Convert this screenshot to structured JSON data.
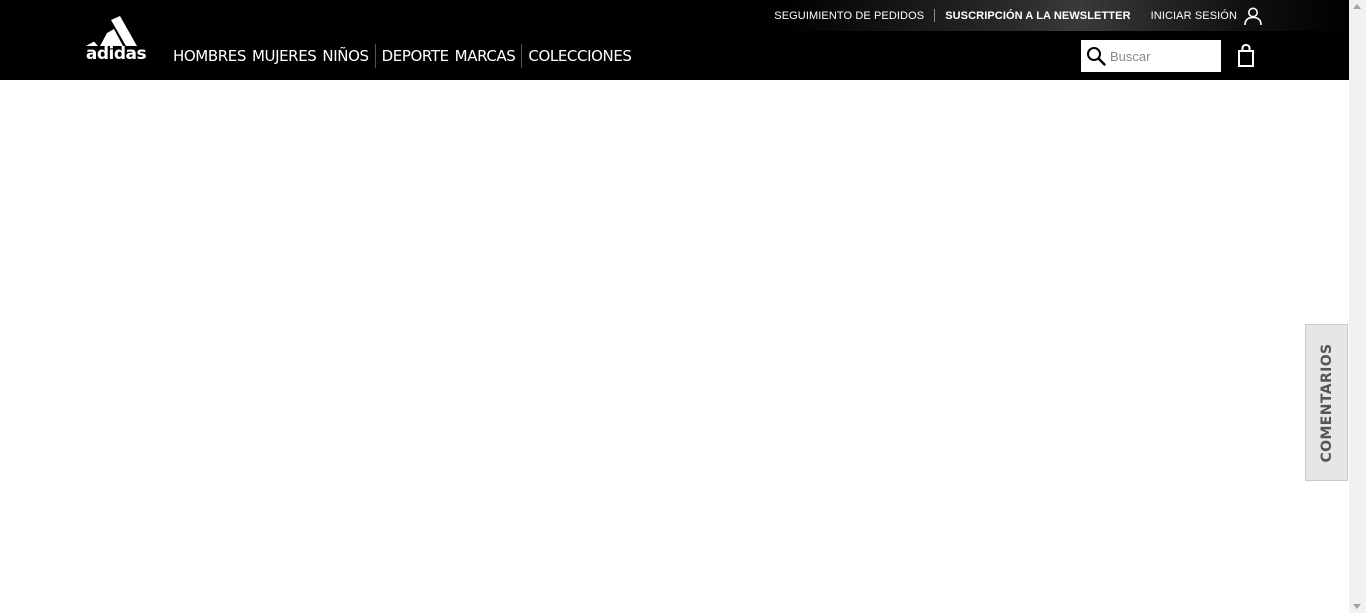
{
  "brand": {
    "logo_text": "adidas",
    "colors": {
      "header_bg": "#000000",
      "header_text": "#ffffff",
      "feedback_bg": "#e6e6e6",
      "feedback_text": "#555555"
    }
  },
  "topbar": {
    "order_tracking": "SEGUIMIENTO DE PEDIDOS",
    "newsletter": "SUSCRIPCIÓN A LA NEWSLETTER",
    "login": "INICIAR SESIÓN",
    "login_icon": "user-icon"
  },
  "nav": {
    "men": "HOMBRES",
    "women": "MUJERES",
    "kids": "NIÑOS",
    "sport": "DEPORTE",
    "brands": "MARCAS",
    "collections": "COLECCIONES"
  },
  "search": {
    "placeholder": "Buscar",
    "value": "",
    "icon": "search-icon"
  },
  "cart": {
    "icon": "shopping-bag-icon"
  },
  "feedback": {
    "label": "COMENTARIOS"
  }
}
